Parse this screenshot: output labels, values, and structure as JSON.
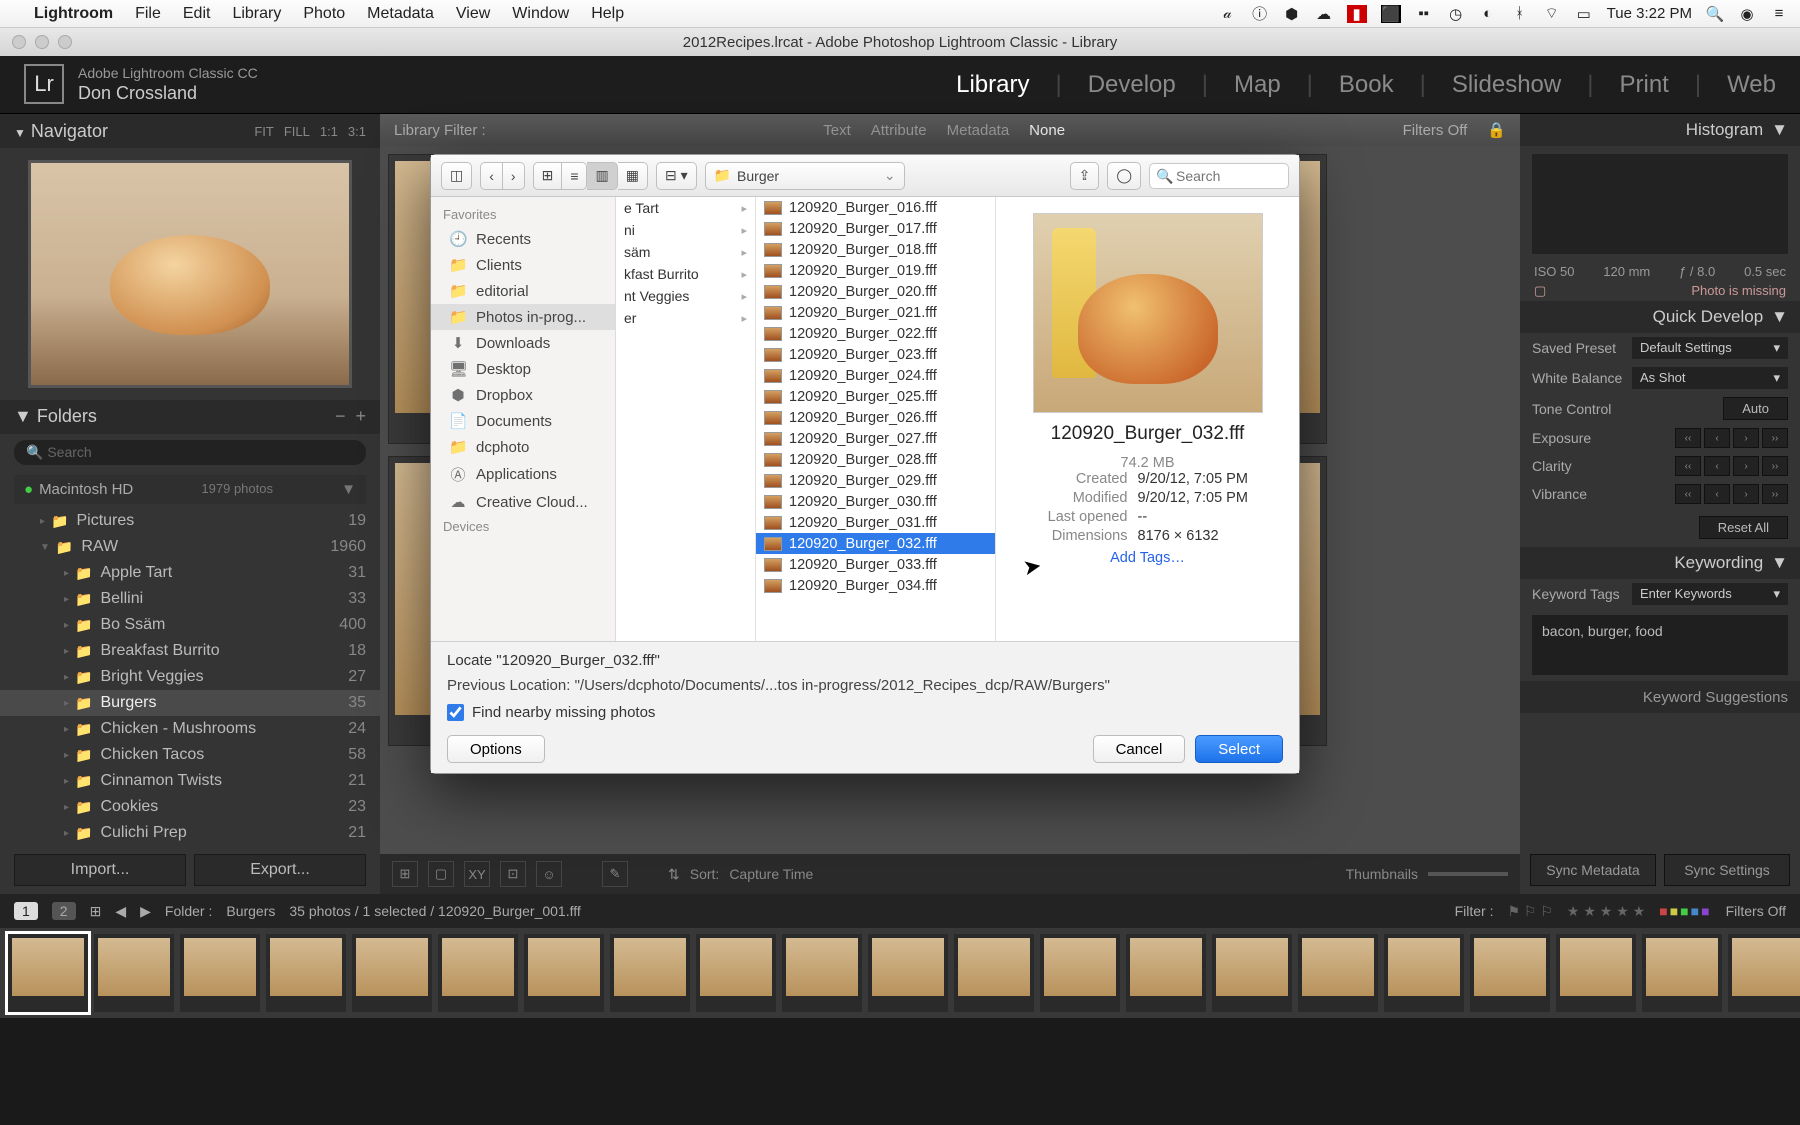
{
  "mac_menu": {
    "app": "Lightroom",
    "items": [
      "File",
      "Edit",
      "Library",
      "Photo",
      "Metadata",
      "View",
      "Window",
      "Help"
    ],
    "clock": "Tue 3:22 PM"
  },
  "window_title": "2012Recipes.lrcat - Adobe Photoshop Lightroom Classic - Library",
  "brand": {
    "product": "Adobe Lightroom Classic CC",
    "user": "Don Crossland"
  },
  "modules": [
    "Library",
    "Develop",
    "Map",
    "Book",
    "Slideshow",
    "Print",
    "Web"
  ],
  "active_module": "Library",
  "navigator": {
    "title": "Navigator",
    "opts": [
      "FIT",
      "FILL",
      "1:1",
      "3:1"
    ]
  },
  "folders": {
    "title": "Folders",
    "search_placeholder": "Search",
    "volume": {
      "name": "Macintosh HD",
      "count": "1979 photos"
    },
    "tree": [
      {
        "name": "Pictures",
        "count": "19",
        "depth": 0
      },
      {
        "name": "RAW",
        "count": "1960",
        "depth": 0,
        "expanded": true
      },
      {
        "name": "Apple Tart",
        "count": "31",
        "depth": 1
      },
      {
        "name": "Bellini",
        "count": "33",
        "depth": 1
      },
      {
        "name": "Bo Ssäm",
        "count": "400",
        "depth": 1
      },
      {
        "name": "Breakfast Burrito",
        "count": "18",
        "depth": 1
      },
      {
        "name": "Bright Veggies",
        "count": "27",
        "depth": 1
      },
      {
        "name": "Burgers",
        "count": "35",
        "depth": 1,
        "selected": true
      },
      {
        "name": "Chicken - Mushrooms",
        "count": "24",
        "depth": 1
      },
      {
        "name": "Chicken Tacos",
        "count": "58",
        "depth": 1
      },
      {
        "name": "Cinnamon Twists",
        "count": "21",
        "depth": 1
      },
      {
        "name": "Cookies",
        "count": "23",
        "depth": 1
      },
      {
        "name": "Culichi Prep",
        "count": "21",
        "depth": 1
      }
    ],
    "import": "Import...",
    "export": "Export..."
  },
  "library_filter": {
    "label": "Library Filter :",
    "tabs": [
      "Text",
      "Attribute",
      "Metadata",
      "None"
    ],
    "active": "None",
    "filters_off": "Filters Off"
  },
  "histogram": {
    "title": "Histogram",
    "iso": "ISO 50",
    "focal": "120 mm",
    "aperture": "ƒ / 8.0",
    "shutter": "0.5 sec",
    "missing": "Photo is missing"
  },
  "quick_develop": {
    "title": "Quick Develop",
    "preset_label": "Saved Preset",
    "preset_value": "Default Settings",
    "wb_label": "White Balance",
    "wb_value": "As Shot",
    "tone_label": "Tone Control",
    "auto": "Auto",
    "exposure": "Exposure",
    "clarity": "Clarity",
    "vibrance": "Vibrance",
    "reset": "Reset All"
  },
  "keywording": {
    "title": "Keywording",
    "tags_label": "Keyword Tags",
    "tags_mode": "Enter Keywords",
    "keywords": "bacon, burger, food",
    "suggest": "Keyword Suggestions"
  },
  "sync": {
    "metadata": "Sync Metadata",
    "settings": "Sync Settings"
  },
  "toolbar": {
    "sort_label": "Sort:",
    "sort_value": "Capture Time",
    "thumbs_label": "Thumbnails"
  },
  "filmstrip_info": {
    "folder_label": "Folder :",
    "folder": "Burgers",
    "summary": "35 photos / 1 selected / 120920_Burger_001.fff",
    "filter_label": "Filter :",
    "filters_off": "Filters Off"
  },
  "finder": {
    "path_label": "Burger",
    "search_placeholder": "Search",
    "sidebar": {
      "favorites": "Favorites",
      "items": [
        {
          "icon": "🕘",
          "label": "Recents"
        },
        {
          "icon": "📁",
          "label": "Clients"
        },
        {
          "icon": "📁",
          "label": "editorial"
        },
        {
          "icon": "📁",
          "label": "Photos in-prog...",
          "selected": true
        },
        {
          "icon": "⬇",
          "label": "Downloads"
        },
        {
          "icon": "🖥",
          "label": "Desktop"
        },
        {
          "icon": "⬢",
          "label": "Dropbox"
        },
        {
          "icon": "📄",
          "label": "Documents"
        },
        {
          "icon": "📁",
          "label": "dcphoto"
        },
        {
          "icon": "Ⓐ",
          "label": "Applications"
        },
        {
          "icon": "☁",
          "label": "Creative Cloud..."
        }
      ],
      "devices": "Devices"
    },
    "col1": [
      "e Tart",
      "ni",
      "säm",
      "kfast Burrito",
      "nt Veggies",
      "er"
    ],
    "col2": [
      "120920_Burger_016.fff",
      "120920_Burger_017.fff",
      "120920_Burger_018.fff",
      "120920_Burger_019.fff",
      "120920_Burger_020.fff",
      "120920_Burger_021.fff",
      "120920_Burger_022.fff",
      "120920_Burger_023.fff",
      "120920_Burger_024.fff",
      "120920_Burger_025.fff",
      "120920_Burger_026.fff",
      "120920_Burger_027.fff",
      "120920_Burger_028.fff",
      "120920_Burger_029.fff",
      "120920_Burger_030.fff",
      "120920_Burger_031.fff",
      "120920_Burger_032.fff",
      "120920_Burger_033.fff",
      "120920_Burger_034.fff"
    ],
    "selected_file": "120920_Burger_032.fff",
    "preview": {
      "filename": "120920_Burger_032.fff",
      "size": "74.2 MB",
      "created_k": "Created",
      "created_v": "9/20/12, 7:05 PM",
      "modified_k": "Modified",
      "modified_v": "9/20/12, 7:05 PM",
      "lastopened_k": "Last opened",
      "lastopened_v": "--",
      "dimensions_k": "Dimensions",
      "dimensions_v": "8176 × 6132",
      "addtags": "Add Tags…"
    },
    "locate": "Locate \"120920_Burger_032.fff\"",
    "previous": "Previous Location: \"/Users/dcphoto/Documents/...tos in-progress/2012_Recipes_dcp/RAW/Burgers\"",
    "find_nearby": "Find nearby missing photos",
    "options": "Options",
    "cancel": "Cancel",
    "select": "Select"
  }
}
